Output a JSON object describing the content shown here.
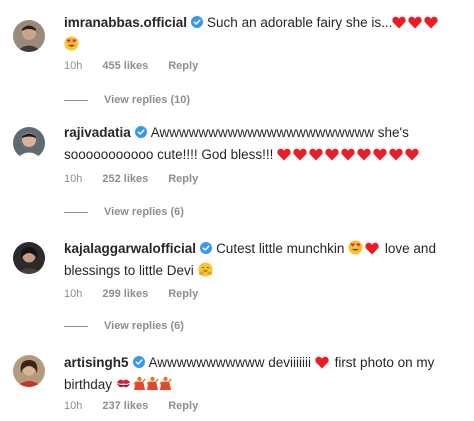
{
  "comments": [
    {
      "username": "imranabbas.official",
      "text": "Such an adorable fairy she is...",
      "time": "10h",
      "likes": "455 likes",
      "reply": "Reply",
      "view_replies": "View replies (10)"
    },
    {
      "username": "rajivadatia",
      "text": "Awwwwwwwwwwwwwwwwwwwwww she's sooooooooooo cute!!!! God bless!!!",
      "time": "10h",
      "likes": "252 likes",
      "reply": "Reply",
      "view_replies": "View replies (6)"
    },
    {
      "username": "kajalaggarwalofficial",
      "text_a": "Cutest little munchkin",
      "text_b": "love and",
      "text_c": "blessings to little Devi",
      "time": "10h",
      "likes": "299 likes",
      "reply": "Reply",
      "view_replies": "View replies (6)"
    },
    {
      "username": "artisingh5",
      "text_a": "Awwwwwwwwwww deviiiiiii",
      "text_b": "first photo on my",
      "text_c": "birthday",
      "time": "10h",
      "likes": "237 likes",
      "reply": "Reply"
    }
  ],
  "colors": {
    "text": "#262626",
    "muted": "#8e8e8e",
    "verified": "#3897f0",
    "heart": "#ed1c24"
  },
  "icons": {
    "verified": "verified-badge-icon",
    "heart": "red-heart-emoji",
    "heart_eyes": "heart-eyes-emoji",
    "hug": "hugging-face-emoji",
    "kiss": "kiss-mark-emoji",
    "dancer": "dancing-emoji"
  }
}
